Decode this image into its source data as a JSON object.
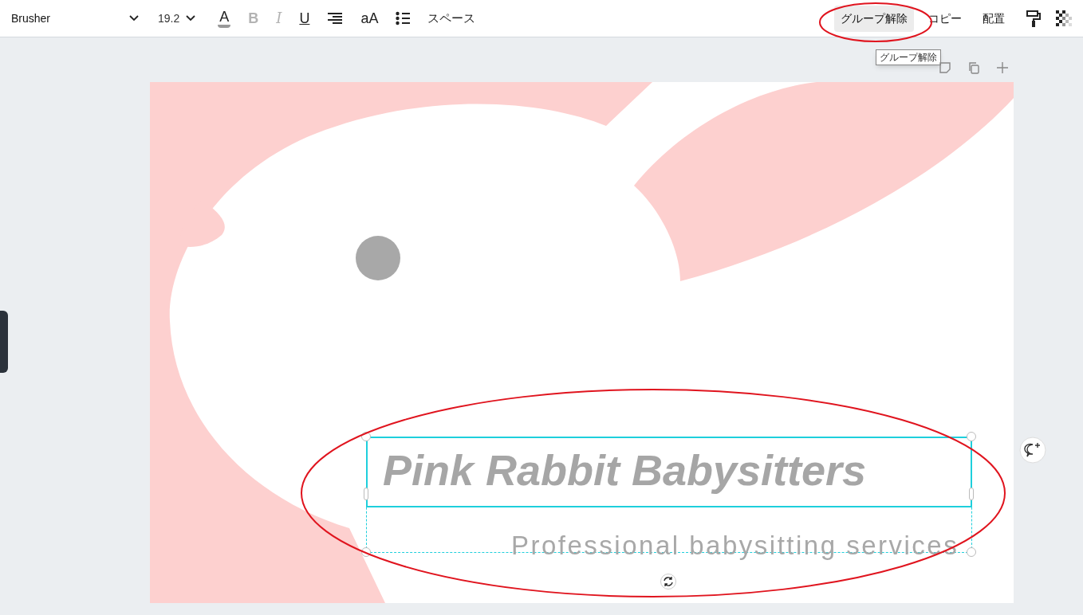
{
  "toolbar": {
    "font": "Brusher",
    "font_size": "19.2",
    "format_items": [
      {
        "kind": "color-a",
        "label": "A",
        "disabled": false
      },
      {
        "kind": "bold",
        "label": "B",
        "disabled": true
      },
      {
        "kind": "italic",
        "label": "I",
        "disabled": true
      },
      {
        "kind": "underline",
        "label": "U",
        "disabled": false
      },
      {
        "kind": "align",
        "disabled": false
      },
      {
        "kind": "case",
        "label": "aA",
        "disabled": false
      },
      {
        "kind": "list",
        "disabled": false
      },
      {
        "kind": "text",
        "label": "スペース",
        "disabled": false
      }
    ],
    "actions": [
      {
        "label": "グループ解除",
        "selected": true
      },
      {
        "label": "コピー",
        "selected": false
      },
      {
        "label": "配置",
        "selected": false
      }
    ]
  },
  "tooltip": "グループ解除",
  "design": {
    "title": "Pink Rabbit Babysitters",
    "subtitle": "Professional babysitting services"
  }
}
